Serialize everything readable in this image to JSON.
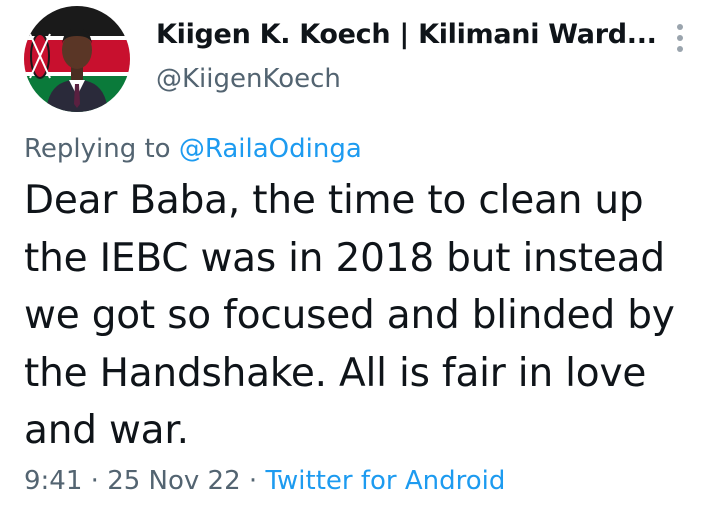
{
  "tweet": {
    "author": {
      "display_name": "Kiigen K. Koech | Kilimani Ward...",
      "handle": "@KiigenKoech",
      "avatar_icon": "profile-photo-kenya-flag"
    },
    "reply_to": {
      "prefix": "Replying to",
      "mention": "@RailaOdinga"
    },
    "text_lines": [
      "Dear Baba, the time to clean up",
      "the IEBC was in 2018 but instead",
      "we got so focused and blinded by",
      "the Handshake. All is fair in love",
      "and war."
    ],
    "meta": {
      "time": "9:41",
      "separator": "·",
      "date": "25 Nov 22",
      "source": "Twitter for Android"
    },
    "more_icon": "more-vertical-icon"
  },
  "colors": {
    "text_primary": "#0f1419",
    "text_secondary": "#536471",
    "link": "#1d9bf0"
  }
}
